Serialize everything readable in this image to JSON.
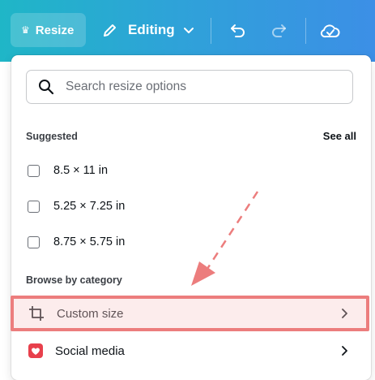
{
  "toolbar": {
    "resize_label": "Resize",
    "editing_label": "Editing",
    "icons": [
      "crown-icon",
      "pencil-icon",
      "chevron-down-icon",
      "undo-icon",
      "redo-icon",
      "cloud-check-icon"
    ]
  },
  "panel": {
    "search": {
      "placeholder": "Search resize options",
      "value": ""
    },
    "suggested": {
      "title": "Suggested",
      "see_all": "See all",
      "items": [
        {
          "label": "8.5 × 11 in"
        },
        {
          "label": "5.25 × 7.25 in"
        },
        {
          "label": "8.75 × 5.75 in"
        }
      ]
    },
    "browse": {
      "title": "Browse by category",
      "items": [
        {
          "label": "Custom size",
          "icon": "custom-size-icon"
        },
        {
          "label": "Social media",
          "icon": "social-media-icon"
        }
      ]
    }
  },
  "colors": {
    "toolbar_gradient_start": "#1fb6c7",
    "toolbar_gradient_end": "#3c8fe6",
    "highlight": "#ec7d7d",
    "social_icon": "#e8404c"
  }
}
